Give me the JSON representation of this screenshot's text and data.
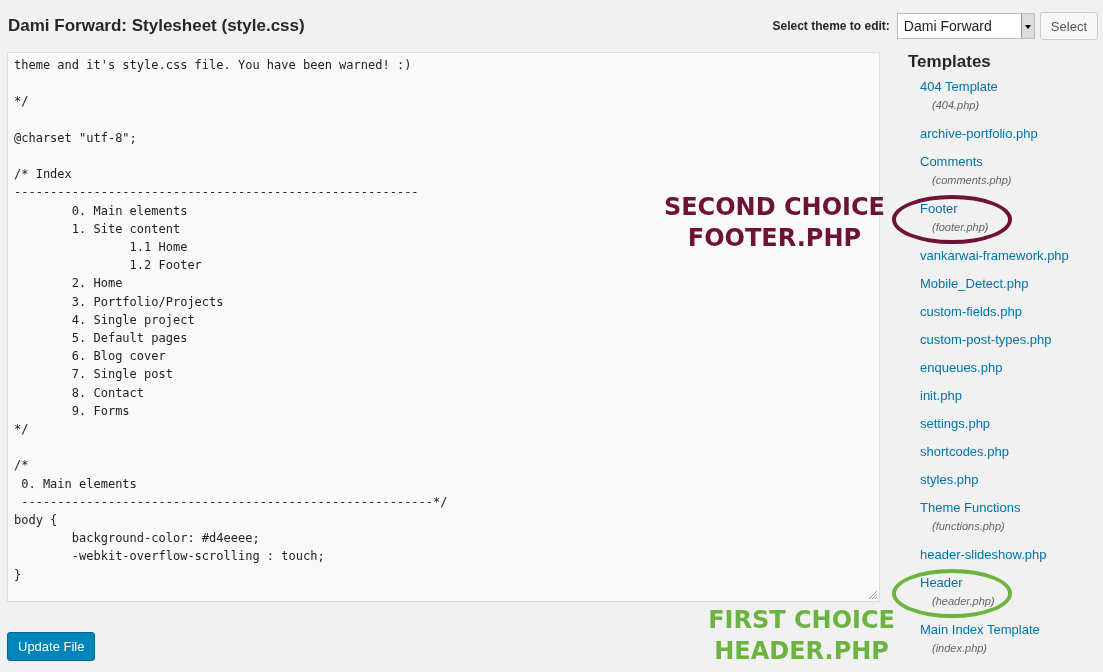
{
  "page_title": "Dami Forward: Stylesheet (style.css)",
  "theme_selector": {
    "label": "Select theme to edit:",
    "value": "Dami Forward",
    "button": "Select"
  },
  "editor": {
    "code": "theme and it's style.css file. You have been warned! :)\n\n*/\n\n@charset \"utf-8\";\n\n/* Index\n--------------------------------------------------------\n\t0. Main elements\n\t1. Site content\n\t\t1.1 Home\n\t\t1.2 Footer\n\t2. Home\n\t3. Portfolio/Projects\n\t4. Single project\n\t5. Default pages\n\t6. Blog cover\n\t7. Single post\n\t8. Contact\n\t9. Forms\n*/\n\n/*\n 0. Main elements\n ---------------------------------------------------------*/\nbody {\n\tbackground-color: #d4eeee;\n\t-webkit-overflow-scrolling : touch;\n}"
  },
  "update_button": "Update File",
  "templates": {
    "heading": "Templates",
    "items": [
      {
        "label": "404 Template",
        "file": "(404.php)"
      },
      {
        "label": "archive-portfolio.php"
      },
      {
        "label": "Comments",
        "file": "(comments.php)"
      },
      {
        "label": "Footer",
        "file": "(footer.php)",
        "annotation": {
          "lines": [
            "SECOND CHOICE",
            "FOOTER.PHP"
          ],
          "color": "#6e1336",
          "kind": "beside"
        }
      },
      {
        "label": "vankarwai-framework.php"
      },
      {
        "label": "Mobile_Detect.php"
      },
      {
        "label": "custom-fields.php"
      },
      {
        "label": "custom-post-types.php"
      },
      {
        "label": "enqueues.php"
      },
      {
        "label": "init.php"
      },
      {
        "label": "settings.php"
      },
      {
        "label": "shortcodes.php"
      },
      {
        "label": "styles.php"
      },
      {
        "label": "Theme Functions",
        "file": "(functions.php)"
      },
      {
        "label": "header-slideshow.php"
      },
      {
        "label": "Header",
        "file": "(header.php)",
        "annotation": {
          "lines": [
            "FIRST CHOICE",
            "HEADER.PHP"
          ],
          "color": "#6db33f",
          "kind": "below"
        }
      },
      {
        "label": "Main Index Template",
        "file": "(index.php)"
      }
    ]
  }
}
